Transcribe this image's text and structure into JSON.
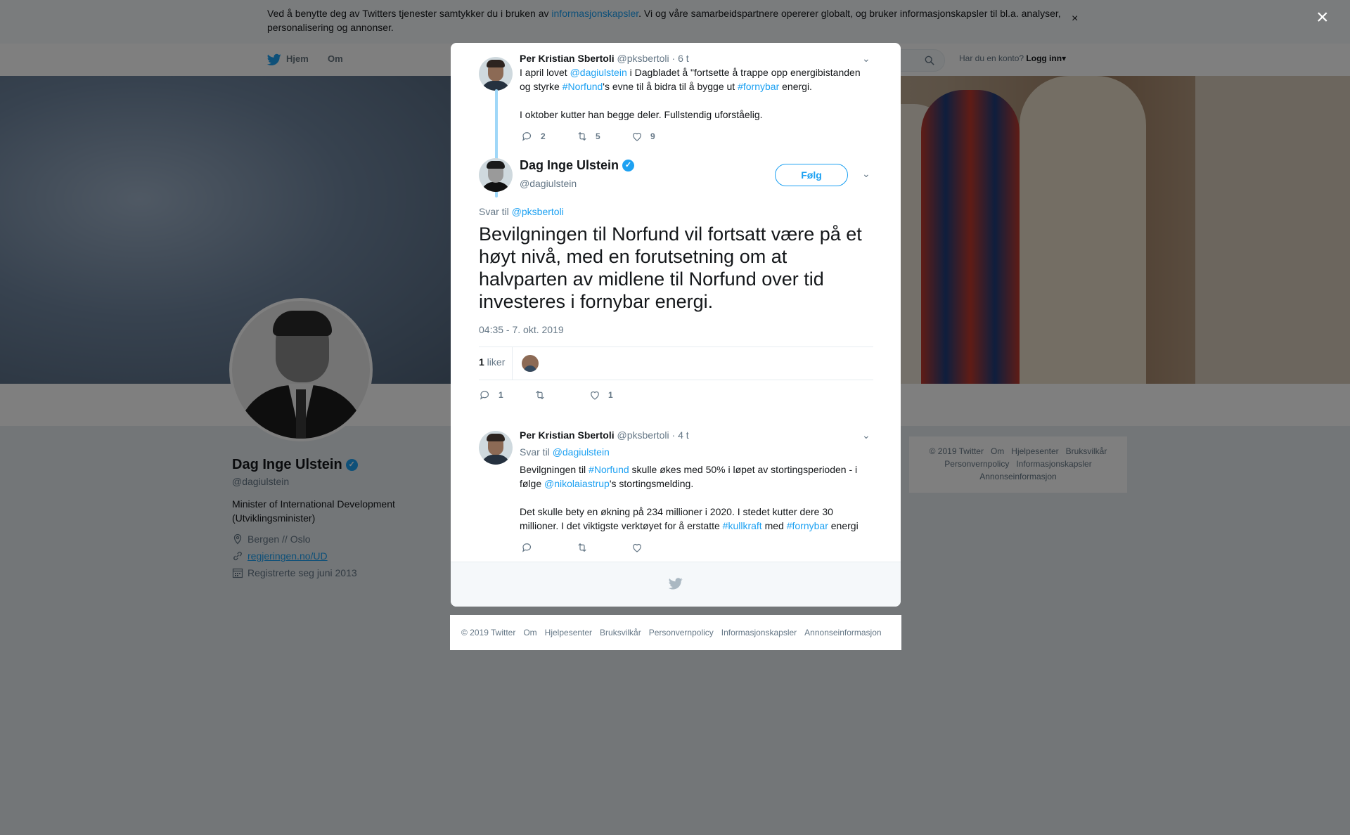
{
  "cookie_banner": {
    "text_before": "Ved å benytte deg av Twitters tjenester samtykker du i bruken av ",
    "link": "informasjonskapsler",
    "text_after": ". Vi og våre samarbeidspartnere opererer globalt, og bruker informasjonskapsler til bl.a. analyser, personalisering og annonser.",
    "close": "×"
  },
  "nav": {
    "home": "Hjem",
    "about": "Om",
    "account_prompt": "Har du en konto?",
    "login": "Logg inn",
    "login_caret": "▾"
  },
  "profile": {
    "name": "Dag Inge Ulstein",
    "handle": "@dagiulstein",
    "bio": "Minister of International Development (Utviklingsminister)",
    "location": "Bergen // Oslo",
    "website": "regjeringen.no/UD",
    "joined": "Registrerte seg juni 2013"
  },
  "side_footer": {
    "items": [
      "© 2019 Twitter",
      "Om",
      "Hjelpesenter",
      "Bruksvilkår",
      "Personvernpolicy",
      "Informasjonskapsler",
      "Annonseinformasjon"
    ]
  },
  "overlay": {
    "close": "×"
  },
  "thread": {
    "parent": {
      "name": "Per Kristian Sbertoli",
      "handle": "@pksbertoli",
      "time": "· 6 t",
      "line1_a": "I april lovet ",
      "line1_mention": "@dagiulstein",
      "line1_b": " i Dagbladet å \"fortsette å trappe opp energibistanden og styrke ",
      "line1_tag1": "#Norfund",
      "line1_c": "'s evne til å bidra til å bygge ut ",
      "line1_tag2": "#fornybar",
      "line1_d": " energi.",
      "line2": "I oktober kutter han begge deler. Fullstendig uforståelig.",
      "replies": "2",
      "retweets": "5",
      "likes": "9"
    },
    "main": {
      "name": "Dag Inge Ulstein",
      "handle": "@dagiulstein",
      "follow": "Følg",
      "reply_prefix": "Svar til ",
      "reply_to": "@pksbertoli",
      "text": "Bevilgningen til Norfund vil fortsatt være på et høyt nivå, med en forutsetning om at halvparten av midlene til Norfund over tid investeres i fornybar energi.",
      "timestamp": "04:35 - 7. okt. 2019",
      "likes_count": "1",
      "likes_label": " liker",
      "replies": "1",
      "retweets": "",
      "likes": "1"
    },
    "reply": {
      "name": "Per Kristian Sbertoli",
      "handle": "@pksbertoli",
      "time": "· 4 t",
      "reply_prefix": "Svar til ",
      "reply_to": "@dagiulstein",
      "p1_a": "Bevilgningen til ",
      "p1_tag": "#Norfund",
      "p1_b": " skulle økes med 50% i løpet av stortingsperioden - i følge ",
      "p1_mention": "@nikolaiastrup",
      "p1_c": "'s stortingsmelding.",
      "p2_a": "Det skulle bety en økning på 234 millioner i 2020. I stedet kutter dere 30 millioner. I det viktigste verktøyet for å erstatte ",
      "p2_tag1": "#kullkraft",
      "p2_b": " med ",
      "p2_tag2": "#fornybar",
      "p2_c": " energi"
    }
  },
  "modal_footer": {
    "items": [
      "© 2019 Twitter",
      "Om",
      "Hjelpesenter",
      "Bruksvilkår",
      "Personvernpolicy",
      "Informasjonskapsler",
      "Annonseinformasjon"
    ]
  },
  "colors": {
    "accent": "#1da1f2",
    "text": "#14171a",
    "muted": "#657786"
  }
}
